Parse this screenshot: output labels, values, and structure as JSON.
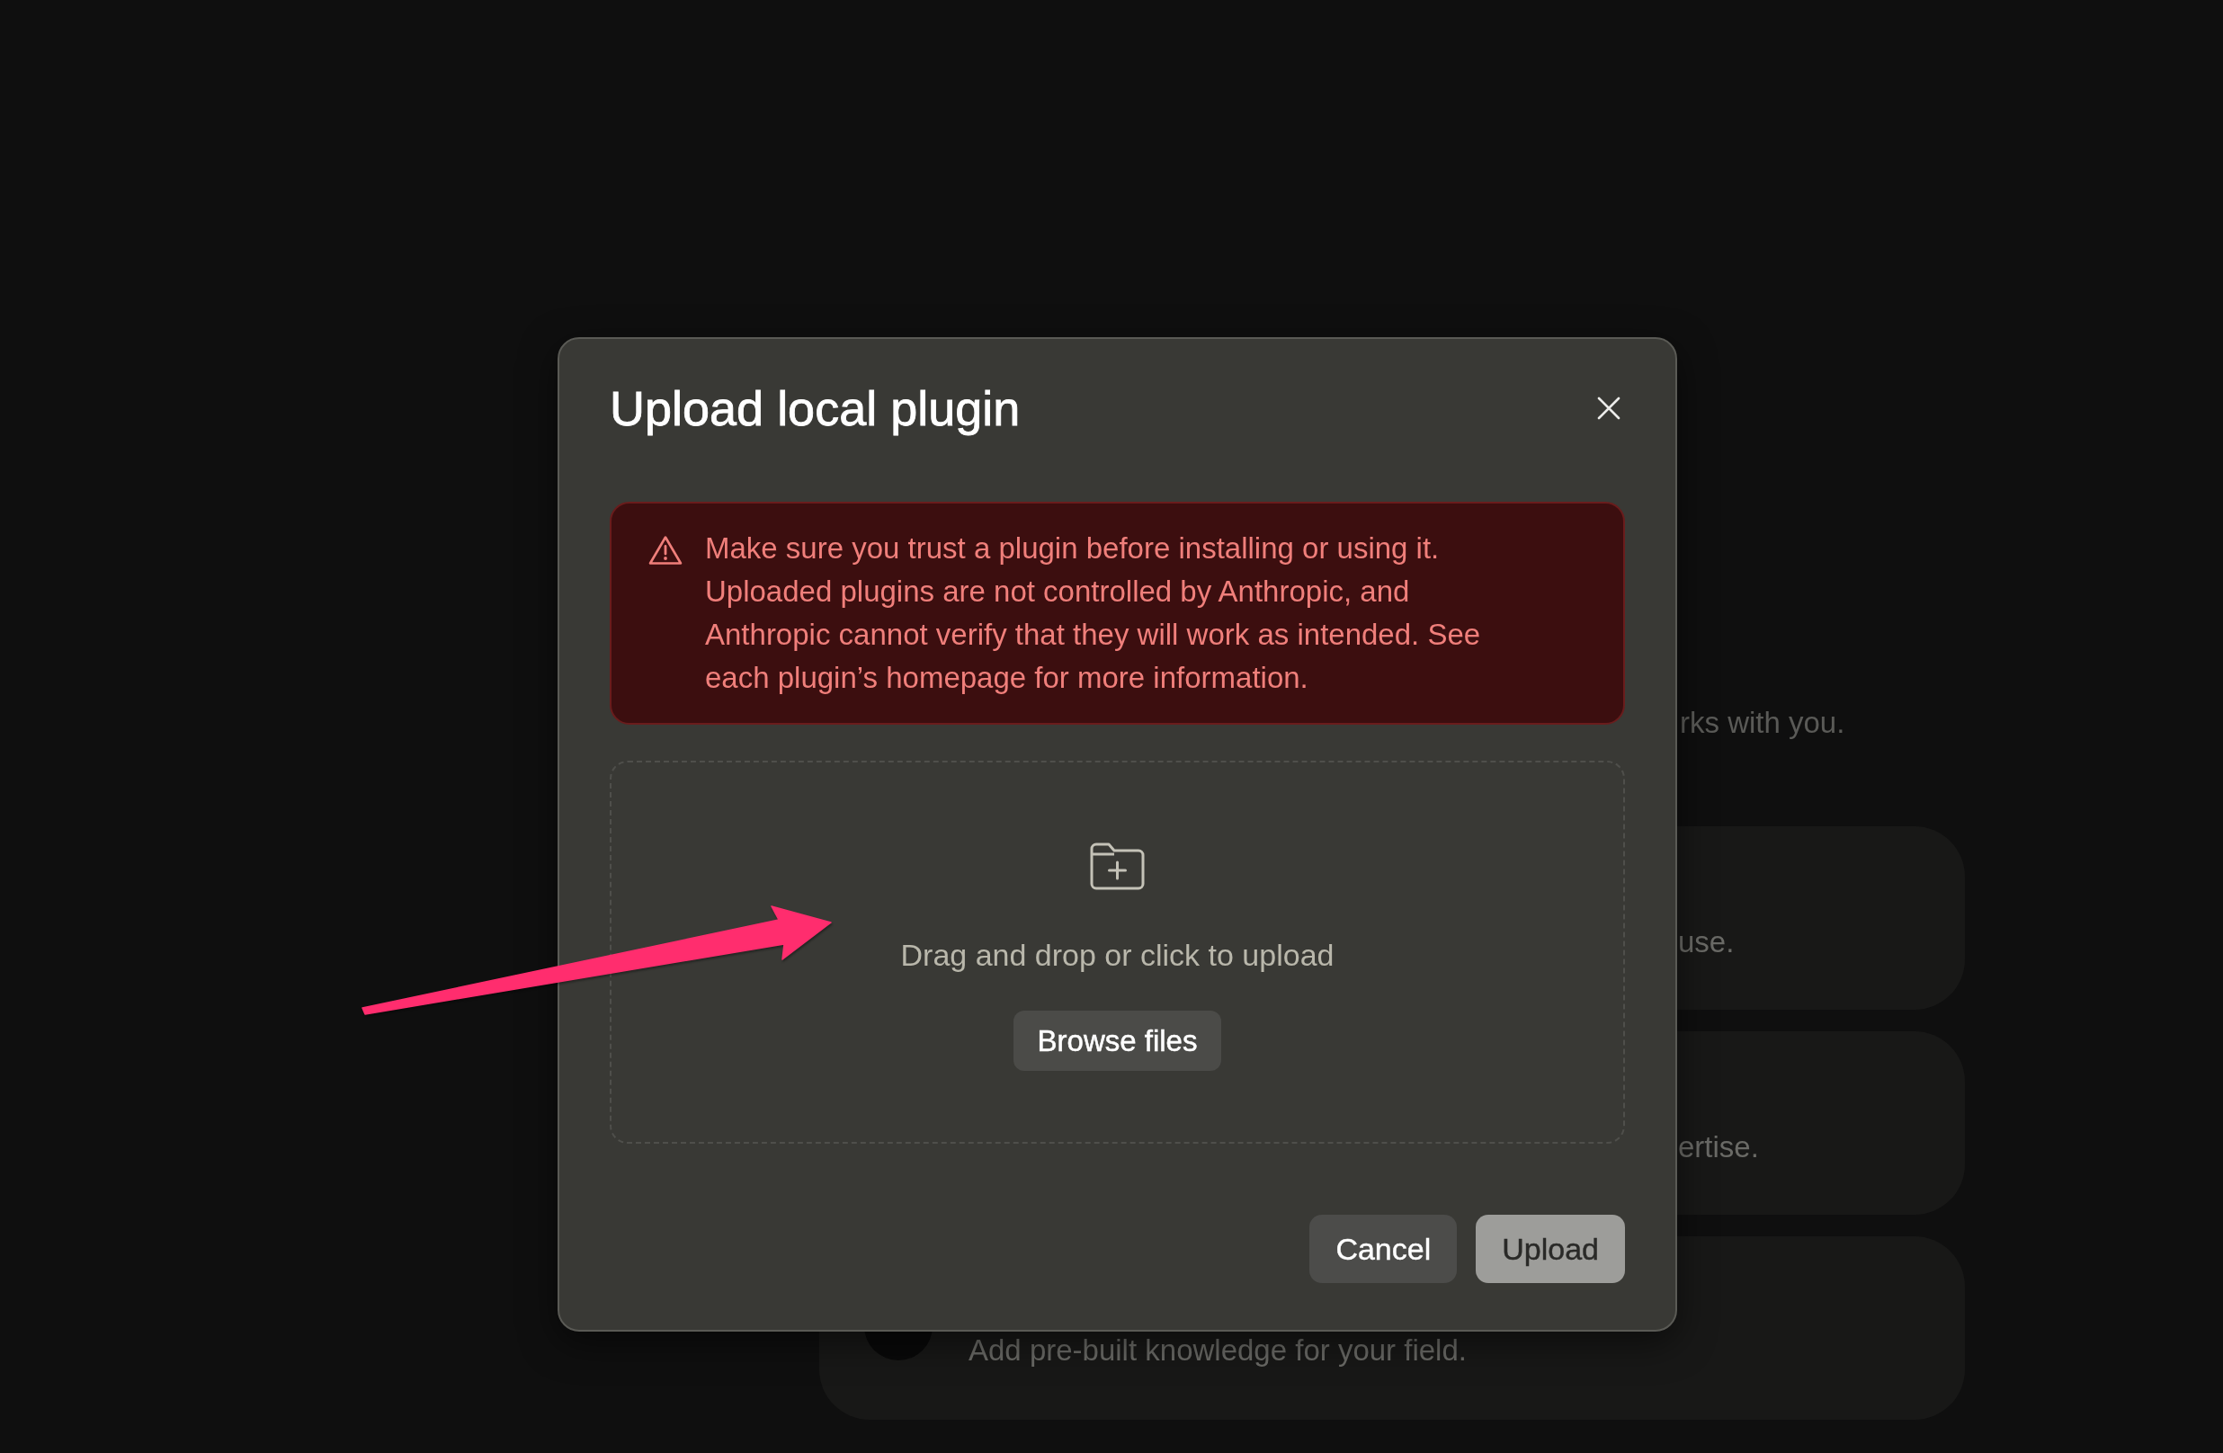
{
  "background": {
    "subtitle": "rks with you.",
    "cards": [
      {
        "kind": "clipped",
        "description": "use."
      },
      {
        "kind": "clipped",
        "description": "ertise."
      },
      {
        "kind": "full",
        "description": "Add pre-built knowledge for your field."
      }
    ]
  },
  "dialog": {
    "title": "Upload local plugin",
    "warning": "Make sure you trust a plugin before installing or using it. Uploaded plugins are not controlled by Anthropic, and Anthropic cannot verify that they will work as intended. See each plugin’s homepage for more information.",
    "dropzone": {
      "hint": "Drag and drop or click to upload",
      "button": "Browse files"
    },
    "actions": [
      {
        "kind": "secondary",
        "label": "Cancel",
        "disabled": false
      },
      {
        "kind": "primary",
        "label": "Upload",
        "disabled": true
      }
    ]
  },
  "annotations": [
    {
      "kind": "arrow"
    }
  ]
}
